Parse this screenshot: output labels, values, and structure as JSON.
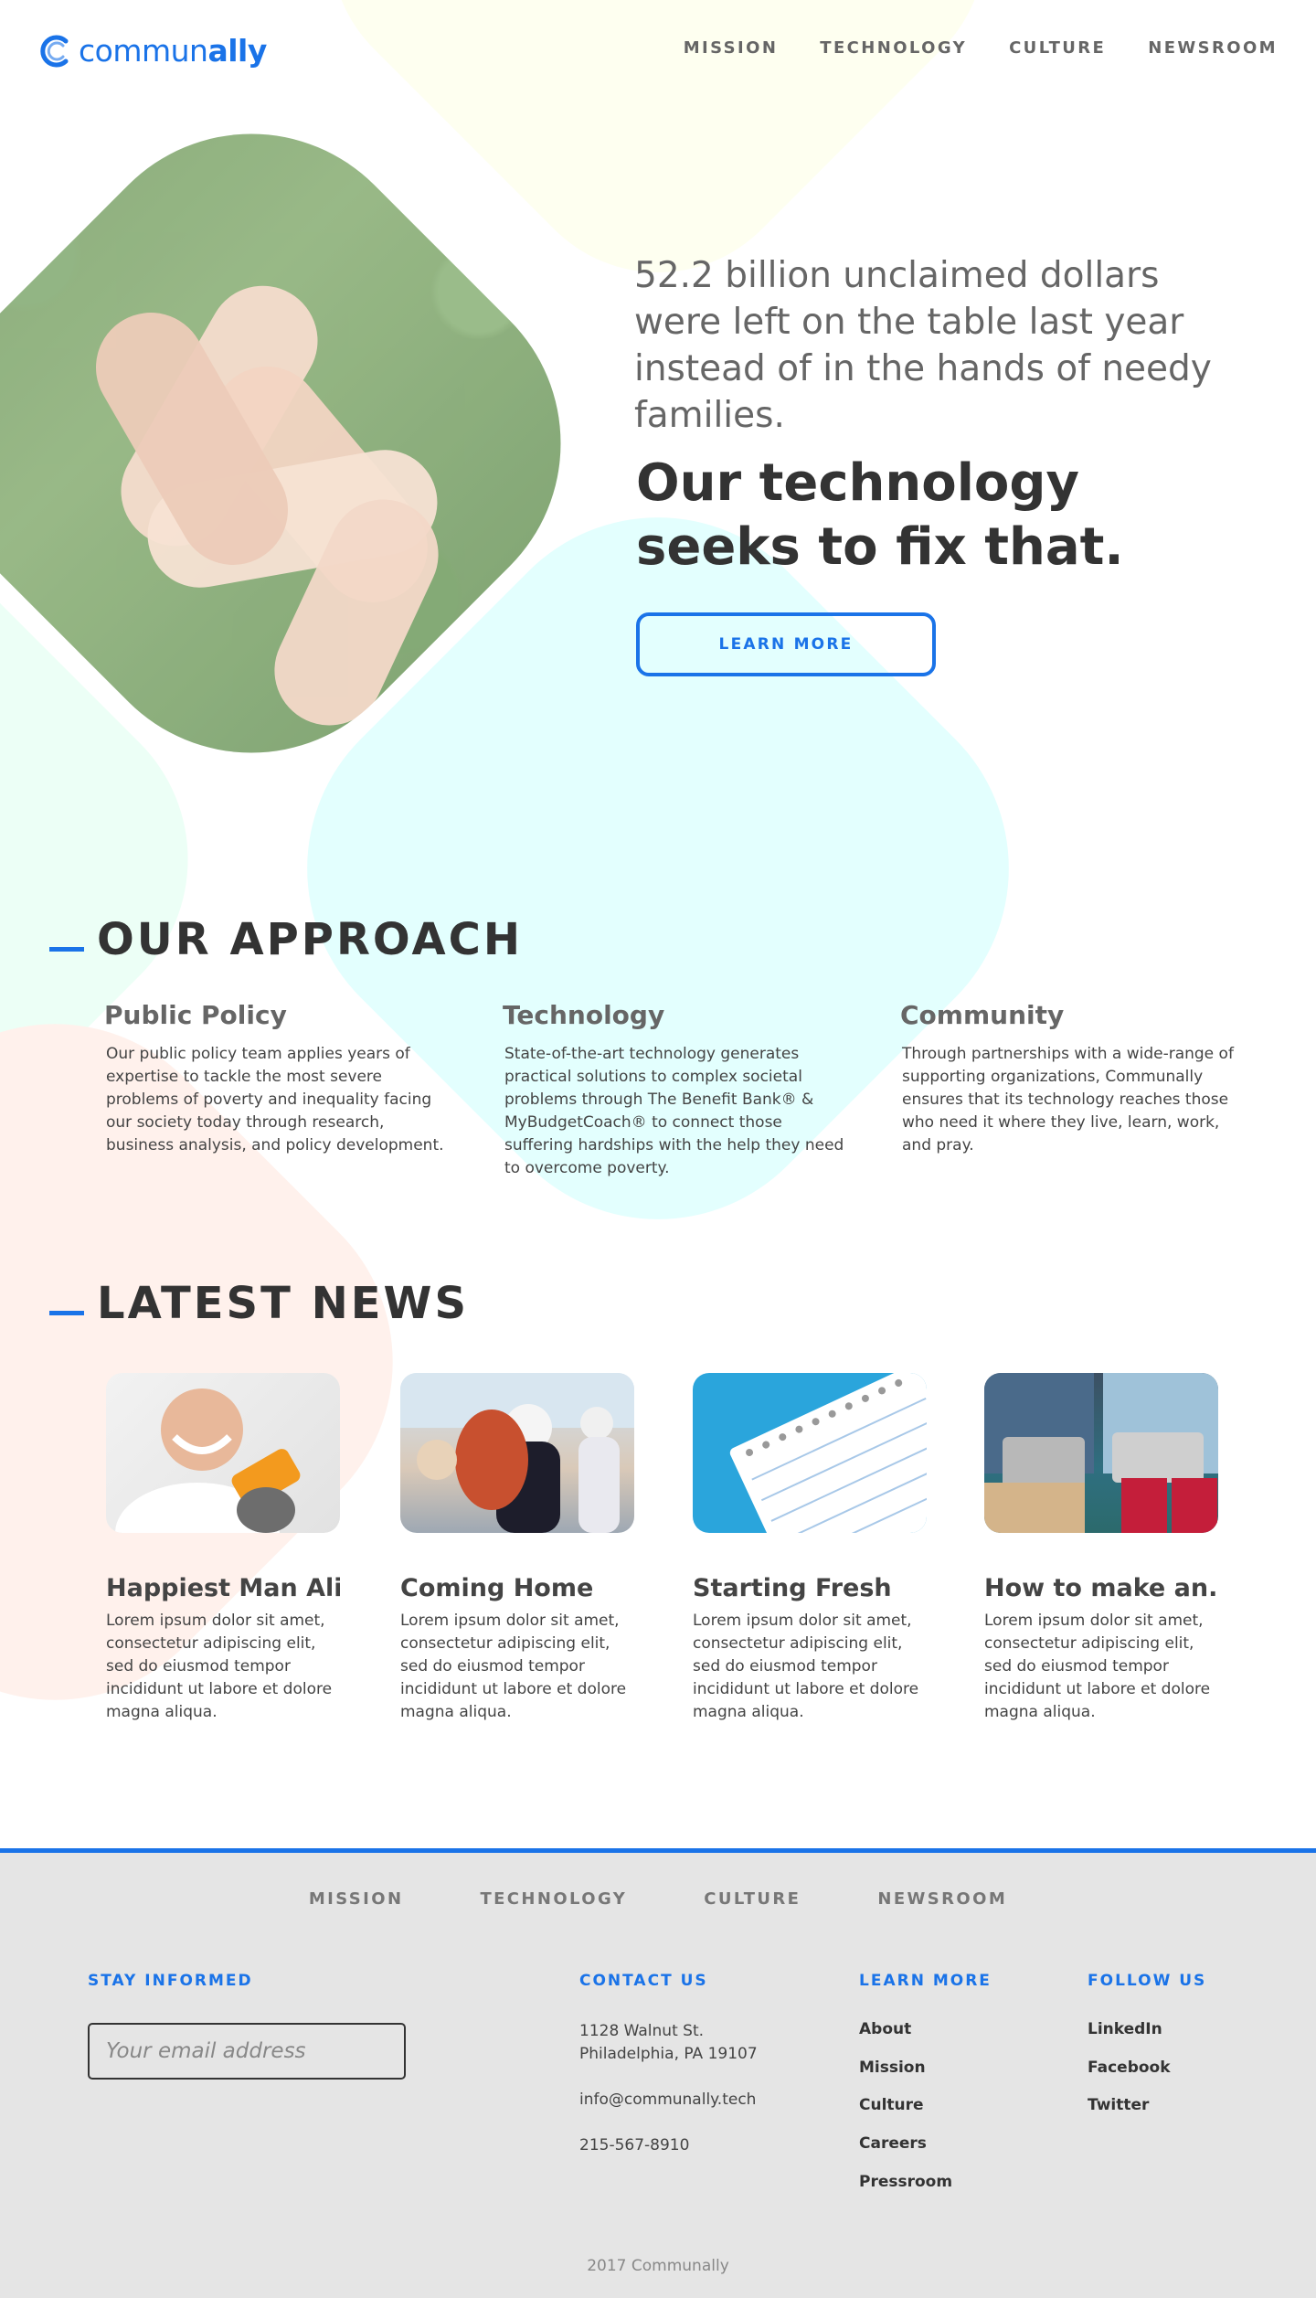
{
  "brand": {
    "prefix": "commun",
    "suffix": "ally",
    "color": "#1a73e8"
  },
  "nav": {
    "items": [
      {
        "label": "MISSION"
      },
      {
        "label": "TECHNOLOGY"
      },
      {
        "label": "CULTURE"
      },
      {
        "label": "NEWSROOM"
      }
    ]
  },
  "hero": {
    "stat_text": "52.2 billion unclaimed dollars were left on the table last year instead of in the hands of needy families.",
    "heading": "Our technology seeks to fix that.",
    "cta_label": "LEARN MORE"
  },
  "approach": {
    "title": "OUR APPROACH",
    "columns": [
      {
        "title": "Public Policy",
        "text": "Our public policy team applies years of expertise to tackle the most severe problems of poverty and inequality facing our society today through research, business analysis, and policy development."
      },
      {
        "title": "Technology",
        "text": "State-of-the-art technology generates practical solutions to complex societal problems through The Benefit Bank® & MyBudgetCoach® to connect those suffering hardships with the help they need to overcome poverty."
      },
      {
        "title": "Community",
        "text": "Through partnerships with a wide-range of supporting organizations, Communally ensures that its technology reaches those who need it where they live, learn, work, and pray."
      }
    ]
  },
  "news": {
    "title": "LATEST NEWS",
    "items": [
      {
        "title": "Happiest Man Alive",
        "text": "Lorem ipsum dolor sit amet, consectetur adipiscing elit, sed do eiusmod tempor incididunt ut labore et dolore magna aliqua."
      },
      {
        "title": "Coming Home",
        "text": "Lorem ipsum dolor sit amet, consectetur adipiscing elit, sed do eiusmod tempor incididunt ut labore et dolore magna aliqua."
      },
      {
        "title": "Starting Fresh",
        "text": "Lorem ipsum dolor sit amet, consectetur adipiscing elit, sed do eiusmod tempor incididunt ut labore et dolore magna aliqua."
      },
      {
        "title": "How to make an...",
        "text": "Lorem ipsum dolor sit amet, consectetur adipiscing elit, sed do eiusmod tempor incididunt ut labore et dolore magna aliqua."
      }
    ]
  },
  "footer": {
    "nav": [
      {
        "label": "MISSION"
      },
      {
        "label": "TECHNOLOGY"
      },
      {
        "label": "CULTURE"
      },
      {
        "label": "NEWSROOM"
      }
    ],
    "stay_informed": {
      "heading": "STAY INFORMED",
      "placeholder": "Your email address"
    },
    "contact": {
      "heading": "CONTACT US",
      "address_line1": "1128 Walnut St.",
      "address_line2": "Philadelphia, PA 19107",
      "email": "info@communally.tech",
      "phone": "215-567-8910"
    },
    "learn_more": {
      "heading": "LEARN MORE",
      "links": [
        {
          "label": "About"
        },
        {
          "label": "Mission"
        },
        {
          "label": "Culture"
        },
        {
          "label": "Careers"
        },
        {
          "label": "Pressroom"
        }
      ]
    },
    "follow_us": {
      "heading": "FOLLOW US",
      "links": [
        {
          "label": "LinkedIn"
        },
        {
          "label": "Facebook"
        },
        {
          "label": "Twitter"
        }
      ]
    },
    "copyright": "2017 Communally"
  }
}
